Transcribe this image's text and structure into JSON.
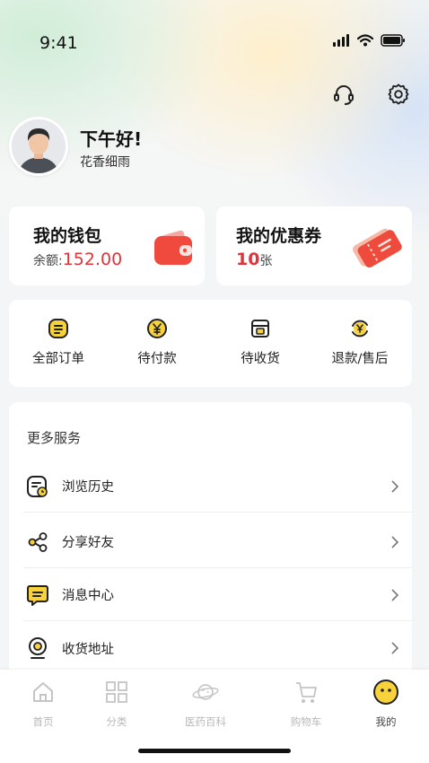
{
  "status_bar": {
    "time": "9:41"
  },
  "profile": {
    "greeting": "下午好!",
    "username": "花香细雨"
  },
  "wallet": {
    "title": "我的钱包",
    "balance_label": "余额:",
    "balance_value": "152.00"
  },
  "coupon": {
    "title": "我的优惠券",
    "count": "10",
    "unit": "张"
  },
  "orders": [
    {
      "label": "全部订单",
      "icon": "order-list-icon"
    },
    {
      "label": "待付款",
      "icon": "yuan-coin-icon"
    },
    {
      "label": "待收货",
      "icon": "package-box-icon"
    },
    {
      "label": "退款/售后",
      "icon": "refund-icon"
    }
  ],
  "services": {
    "title": "更多服务",
    "items": [
      {
        "label": "浏览历史",
        "icon": "history-icon"
      },
      {
        "label": "分享好友",
        "icon": "share-icon"
      },
      {
        "label": "消息中心",
        "icon": "message-icon"
      },
      {
        "label": "收货地址",
        "icon": "location-icon"
      }
    ]
  },
  "tabbar": [
    {
      "label": "首页",
      "icon": "home-icon",
      "active": false
    },
    {
      "label": "分类",
      "icon": "grid-icon",
      "active": false
    },
    {
      "label": "医药百科",
      "icon": "planet-icon",
      "active": false
    },
    {
      "label": "购物车",
      "icon": "cart-icon",
      "active": false
    },
    {
      "label": "我的",
      "icon": "profile-smile-icon",
      "active": true
    }
  ],
  "colors": {
    "accent_yellow": "#f7d23a",
    "price_red": "#e0343b",
    "wallet_red": "#ef4a3d"
  }
}
